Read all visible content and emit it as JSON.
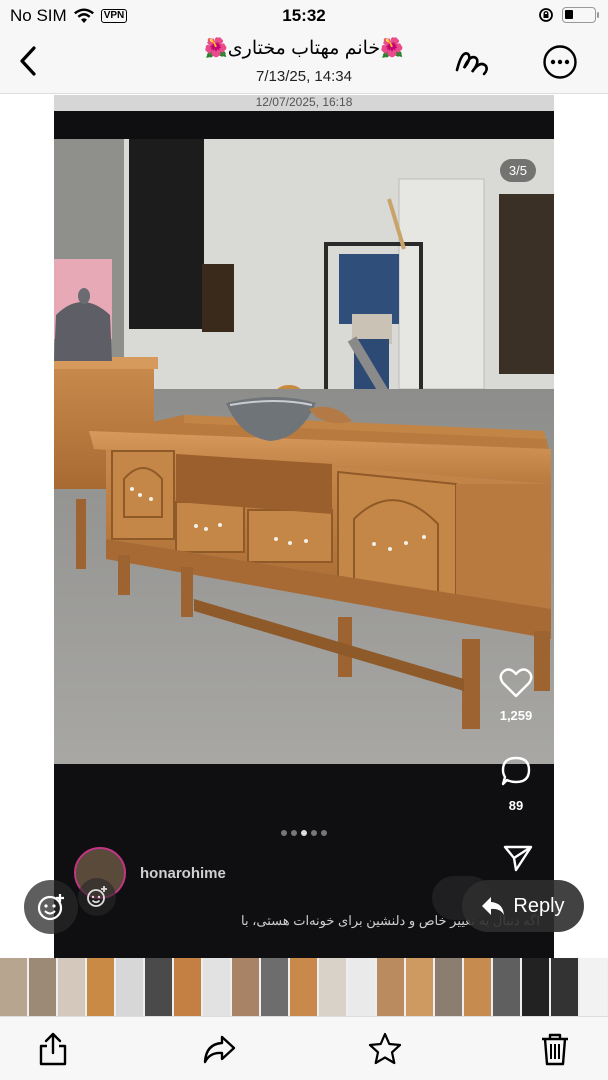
{
  "status_bar": {
    "carrier": "No SIM",
    "vpn_label": "VPN",
    "time": "15:32"
  },
  "nav": {
    "title": "🌺خانم مهتاب مختاری🌺",
    "subtitle": "7/13/25, 14:34"
  },
  "post": {
    "header_timestamp": "12/07/2025, 16:18",
    "page_indicator": "3/5",
    "author": "honarohime",
    "caption": "اگه دنبال یه تغییر خاص و دلنشین برای خونه‌ات هستی، با",
    "like_count": "1,259",
    "comment_count": "89",
    "carousel_dots": 5,
    "active_dot": 3
  },
  "actions": {
    "reply_label": "Reply"
  },
  "colors": {
    "accent": "#000000",
    "wood": "#c9894a"
  },
  "thumbnails": [
    "#b7a58f",
    "#9c8a77",
    "#d3c8bb",
    "#c98a45",
    "#d7d7d7",
    "#4a4a4a",
    "#c48043",
    "#e2e2e2",
    "#a88366",
    "#6d6d6d",
    "#c9894a",
    "#d8d2c8",
    "#eaeaea",
    "#b98b5e",
    "#cf9a62",
    "#8b7d70",
    "#c58b4f",
    "#5f5f5f",
    "#222222",
    "#333333",
    "#f2f2f2",
    "#b9b0a5",
    "#c78a4d",
    "#e5e5e5",
    "#d9cbbd",
    "#a47e58",
    "#7c7c7c",
    "#e8e8e8",
    "#c2883f",
    "#9a9a9a",
    "#ba9067",
    "#d3b08a",
    "#ebebeb",
    "#c9945f",
    "#8a7b6d",
    "#d6d6d6",
    "#c58343",
    "#bcbcbc",
    "#e0d3c5",
    "#a8804f",
    "#2c2c2c",
    "#c88b4a",
    "#777777",
    "#dcdcdc",
    "#b6804a",
    "#9b9b9b",
    "#e9e9e9",
    "#c68644",
    "#d4d4d4",
    "#b59574",
    "#c58a4c",
    "#efefef"
  ]
}
